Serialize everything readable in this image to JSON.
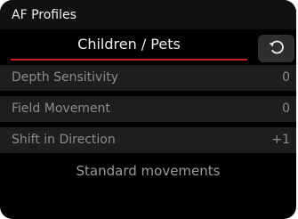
{
  "header": {
    "title": "AF Profiles"
  },
  "profile": {
    "name": "Children / Pets",
    "reset_icon": "reset-icon"
  },
  "settings": [
    {
      "label": "Depth Sensitivity",
      "value": "0"
    },
    {
      "label": "Field Movement",
      "value": "0"
    },
    {
      "label": "Shift in Direction",
      "value": "+1"
    }
  ],
  "footer": {
    "description": "Standard movements"
  },
  "colors": {
    "background": "#000000",
    "header": "#111111",
    "row": "#1e1e1e",
    "accent_underline": "#c81e1e",
    "button": "#2e2e2e"
  }
}
